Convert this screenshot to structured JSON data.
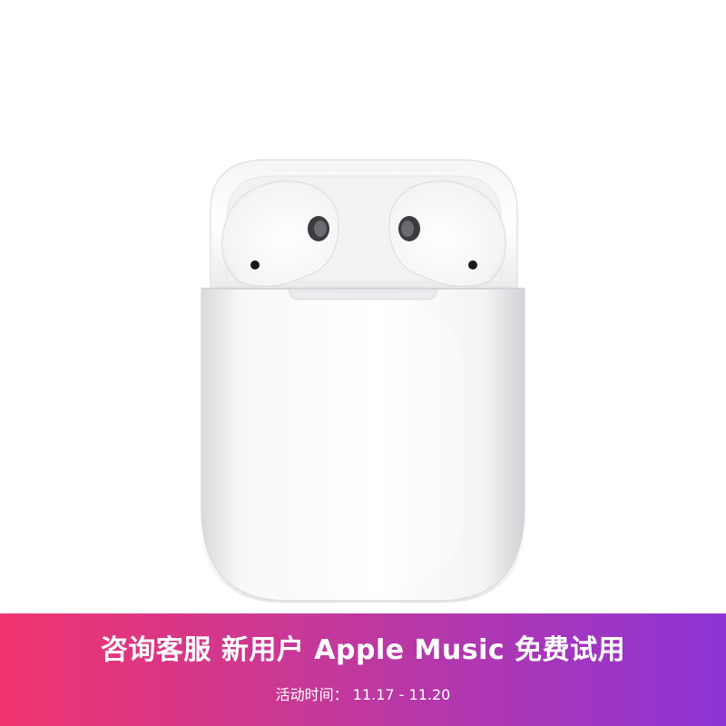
{
  "banner": {
    "headline": "咨询客服 新用户 Apple Music 免费试用",
    "dates": "活动时间： 11.17 - 11.20"
  },
  "colors": {
    "gradient_start": "#f1356f",
    "gradient_end": "#8d34d6",
    "text": "#ffffff"
  },
  "product": {
    "image": "airpods-with-charging-case"
  }
}
